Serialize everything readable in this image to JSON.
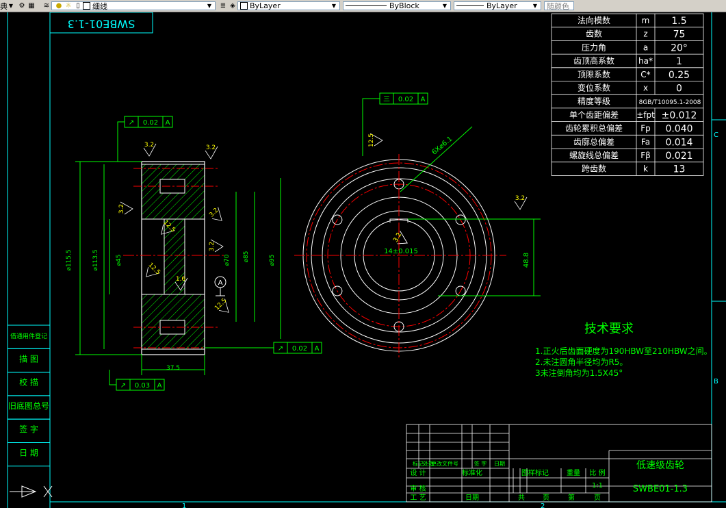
{
  "toolbar": {
    "workspace_tail": "典",
    "layer_name": "细线",
    "color_value": "ByLayer",
    "linetype_value": "ByBlock",
    "lineweight_value": "ByLayer",
    "plotstyle_value": "随颜色",
    "colors": {
      "bg": "#d4d0c8",
      "layer_swatch": "#000000"
    }
  },
  "drawing": {
    "colors": {
      "background": "#000000",
      "border": "#00ffff",
      "outline": "#ffffff",
      "dimension": "#00ff00",
      "center": "#ff0000",
      "hatch": "#00ff00",
      "tech_text": "#00ff00",
      "yellow": "#ffff00"
    },
    "drawing_no_rotated": "SWBE01-1.3",
    "param_table": [
      [
        "法向模数",
        "m",
        "1.5"
      ],
      [
        "齿数",
        "z",
        "75"
      ],
      [
        "压力角",
        "a",
        "20°"
      ],
      [
        "齿顶高系数",
        "ha*",
        "1"
      ],
      [
        "顶隙系数",
        "C*",
        "0.25"
      ],
      [
        "变位系数",
        "x",
        "0"
      ],
      [
        "精度等级",
        "8GB/T10095.1-2008",
        ""
      ],
      [
        "单个齿距偏差",
        "±fpt",
        "±0.012"
      ],
      [
        "齿轮累积总偏差",
        "Fp",
        "0.040"
      ],
      [
        "齿廓总偏差",
        "Fa",
        "0.014"
      ],
      [
        "螺旋线总偏差",
        "Fβ",
        "0.021"
      ],
      [
        "跨齿数",
        "k",
        "13"
      ]
    ],
    "tolerance_frames": [
      {
        "symbol": "↗",
        "value": "0.02",
        "datum": "A"
      },
      {
        "symbol": "三",
        "value": "0.02",
        "datum": "A"
      },
      {
        "symbol": "↗",
        "value": "0.02",
        "datum": "A"
      },
      {
        "symbol": "↗",
        "value": "0.03",
        "datum": "A"
      }
    ],
    "roughness_marks": [
      "3.2",
      "3.2",
      "3.2",
      "3.2",
      "12.5",
      "12.5",
      "3.2",
      "3.2",
      "12.5",
      "1.6",
      "12.5",
      "3.2",
      "3.2"
    ],
    "dimensions": {
      "width": "37.5",
      "d_outer": "⌀115.5",
      "d_root": "⌀113.5",
      "d_a": "⌀95",
      "d_b": "⌀85",
      "d_c": "⌀70",
      "d_bore": "⌀45",
      "holes": "6X⌀6.1",
      "keyway_width": "14±0.015",
      "keyway_depth": "48.8",
      "datum": "A"
    },
    "tech_requirements": {
      "title": "技术要求",
      "items": [
        "1.正火后齿面硬度为190HBW至210HBW之间。",
        "2.未注圆角半径均为R5。",
        "3未注倒角均为1.5X45°"
      ]
    },
    "left_column": [
      "借通用件登记",
      "描 图",
      "校 描",
      "旧底图总号",
      "签 字",
      "日 期"
    ],
    "title_block": {
      "part_name": "低速级齿轮",
      "drawing_no": "SWBE01-1.3",
      "scale": "1:1",
      "row_headers": [
        "标记",
        "处数",
        "更改文件号",
        "签 字",
        "日期"
      ],
      "labels": {
        "design": "设 计",
        "standardize": "标准化",
        "review": "审 核",
        "process": "工 艺",
        "date": "日期",
        "stage_mark": "图样标记",
        "weight": "重量",
        "scale_label": "比 例",
        "total": "共",
        "sheet": "页",
        "page_of": "第",
        "page": "页"
      }
    },
    "zone_marks": {
      "bottom_1": "1",
      "bottom_2": "2",
      "right_b": "B",
      "right_c": "C"
    }
  }
}
